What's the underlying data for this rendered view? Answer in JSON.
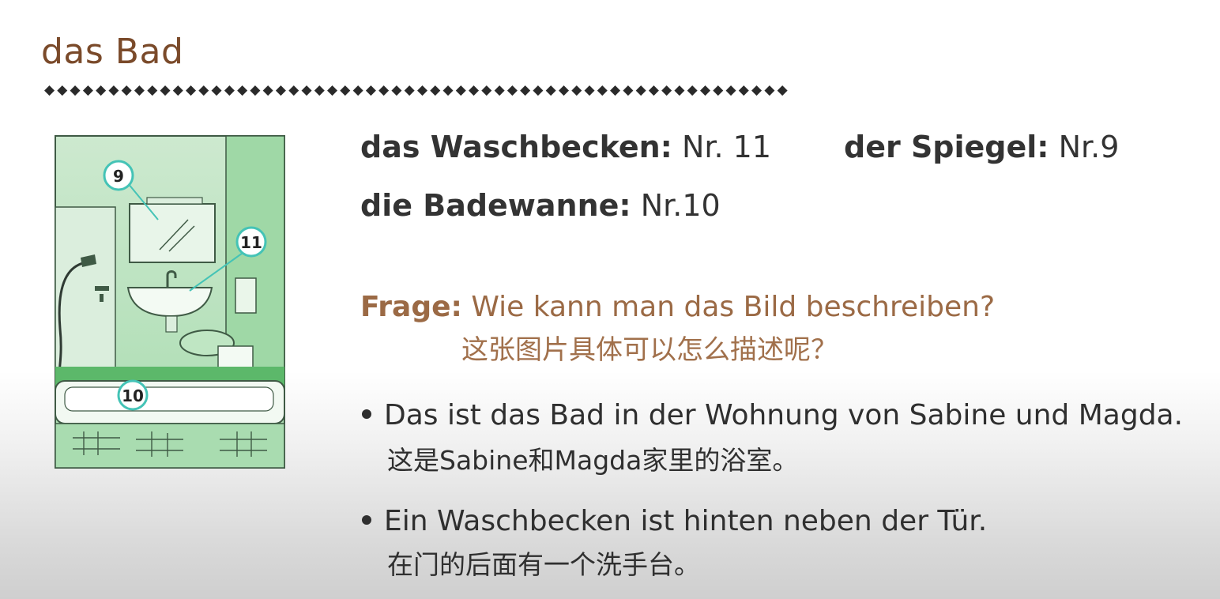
{
  "title": "das Bad",
  "divider_glyph": "◆",
  "vocab": [
    {
      "term": "das Waschbecken:",
      "value": " Nr. 11"
    },
    {
      "term": "der Spiegel:",
      "value": " Nr.9"
    },
    {
      "term": "die Badewanne:",
      "value": " Nr.10"
    }
  ],
  "illustration": {
    "callouts": [
      "9",
      "11",
      "10"
    ],
    "colors": {
      "wall": "#bfe2c2",
      "wall_dark": "#8fcf98",
      "floor": "#5cb86a",
      "tub": "#eef7ef",
      "outline": "#3f5a45",
      "callout_ring": "#44c3b6"
    }
  },
  "question": {
    "label": "Frage:",
    "text": " Wie kann man das Bild beschreiben?",
    "translation": "这张图片具体可以怎么描述呢？"
  },
  "bullets": [
    {
      "text": "Das ist das Bad in der Wohnung von Sabine und Magda.",
      "translation": "这是Sabine和Magda家里的浴室。"
    },
    {
      "text": "Ein Waschbecken ist hinten neben der Tür.",
      "translation": "在门的后面有一个洗手台。"
    }
  ]
}
